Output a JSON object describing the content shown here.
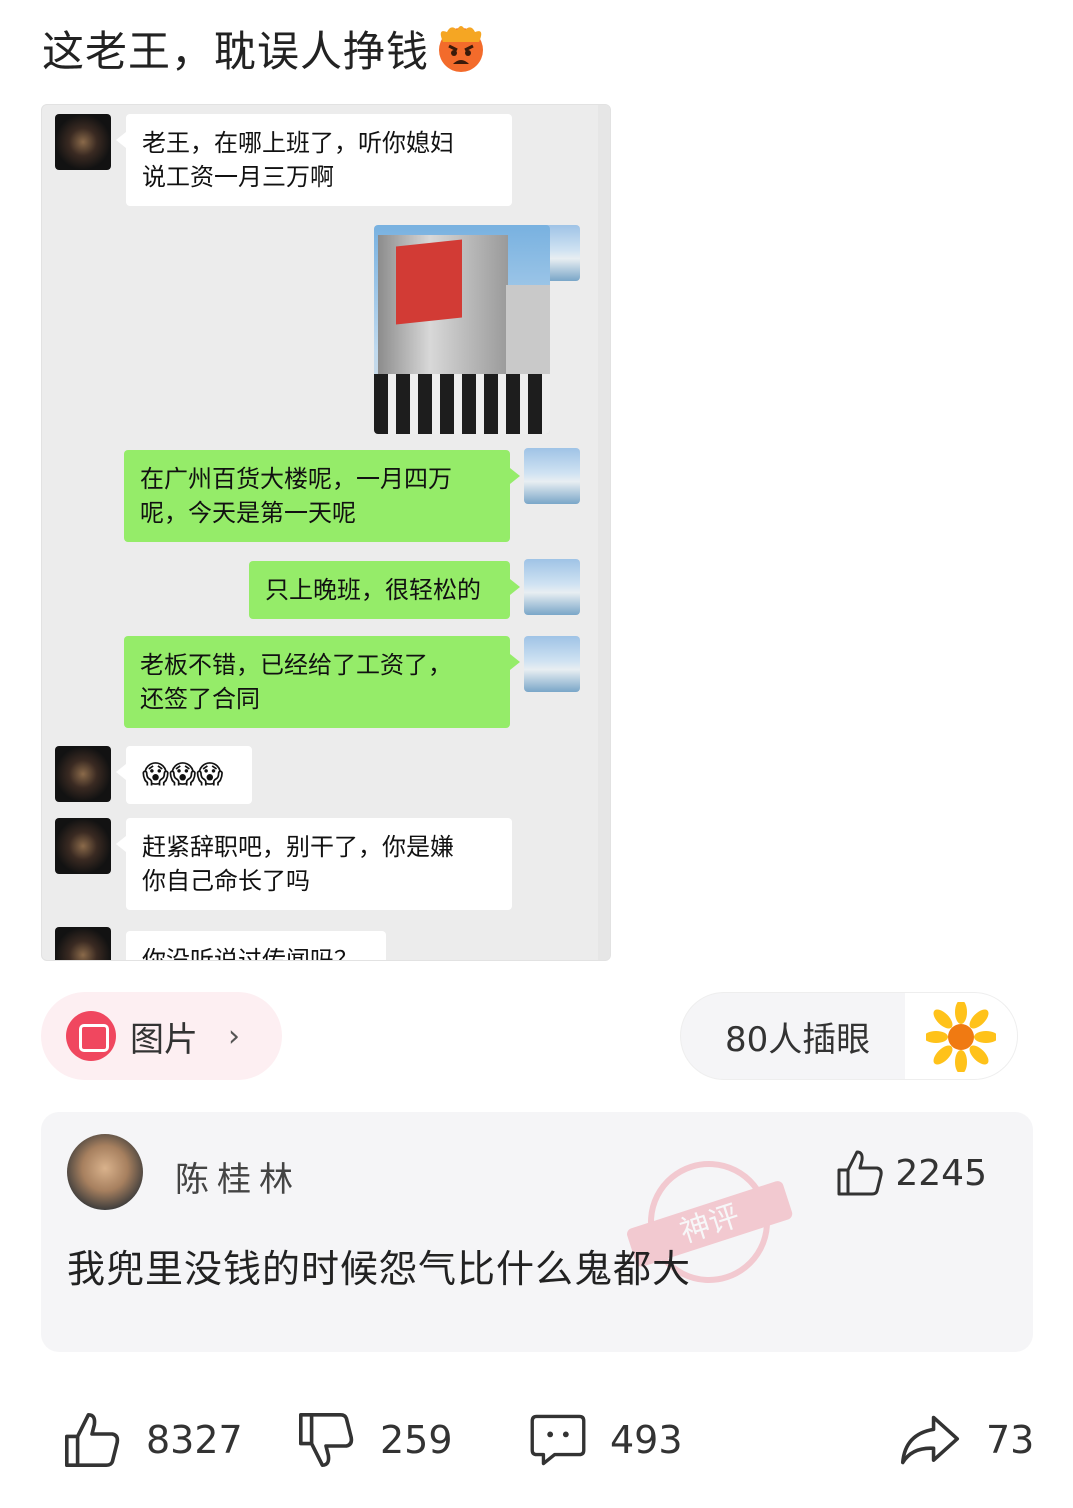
{
  "post": {
    "title": "这老王，耽误人挣钱",
    "title_emoji": "angry-face-emoji"
  },
  "chat_screenshot": {
    "messages": [
      {
        "side": "left",
        "text": "老王，在哪上班了，听你媳妇\n说工资一月三万啊"
      },
      {
        "side": "right",
        "type": "image",
        "desc": "department-store-photo"
      },
      {
        "side": "right",
        "text": "在广州百货大楼呢，一月四万\n呢，今天是第一天呢"
      },
      {
        "side": "right",
        "text": "只上晚班，很轻松的"
      },
      {
        "side": "right",
        "text": "老板不错，已经给了工资了，\n还签了合同"
      },
      {
        "side": "left",
        "text": "😱😱😱"
      },
      {
        "side": "left",
        "text": "赶紧辞职吧，别干了，你是嫌\n你自己命长了吗"
      },
      {
        "side": "left",
        "text": "你没听说过传闻吗？"
      }
    ]
  },
  "tags": {
    "picture_label": "图片",
    "picture_chevron": "›",
    "peek_label": "80人插眼"
  },
  "comment": {
    "username": "陈桂林",
    "likes": "2245",
    "text": "我兜里没钱的时候怨气比什么鬼都大",
    "stamp_text": "神评"
  },
  "actions": {
    "like_count": "8327",
    "dislike_count": "259",
    "comment_count": "493",
    "share_count": "73"
  },
  "colors": {
    "bubble_green": "#95ec69",
    "tag_pink": "#f0475f",
    "card_bg": "#f5f5f7"
  }
}
